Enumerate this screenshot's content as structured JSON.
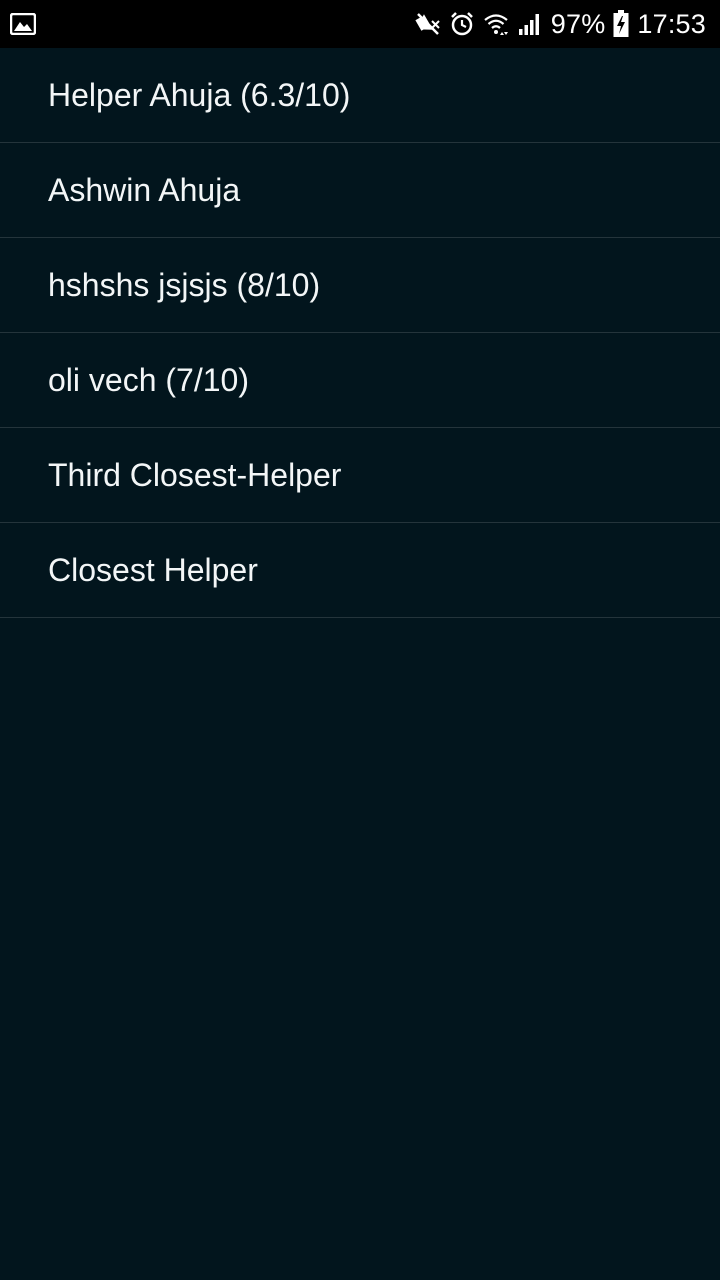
{
  "status_bar": {
    "notification_icon": "image-icon",
    "icons": [
      "mute-icon",
      "alarm-icon",
      "wifi-icon",
      "signal-icon"
    ],
    "battery_percent": "97%",
    "battery_icon": "battery-charging-icon",
    "time": "17:53"
  },
  "helpers": [
    {
      "label": "Helper Ahuja (6.3/10)"
    },
    {
      "label": "Ashwin Ahuja"
    },
    {
      "label": "hshshs jsjsjs (8/10)"
    },
    {
      "label": "oli vech (7/10)"
    },
    {
      "label": "Third Closest-Helper"
    },
    {
      "label": "Closest Helper"
    }
  ],
  "colors": {
    "background": "#02151d",
    "divider": "#24343b",
    "status_bar": "#000000",
    "text": "#f3f6f7"
  }
}
